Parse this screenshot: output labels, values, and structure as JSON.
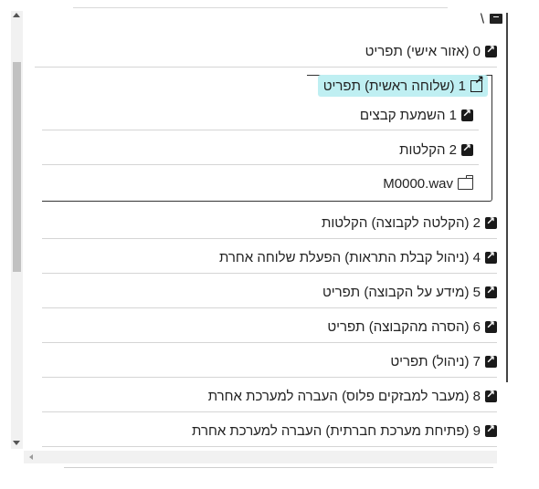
{
  "tree": {
    "root_separator": "\\",
    "items_top": [
      {
        "label": "0 (אזור אישי) תפריט",
        "icon": "shortcut-icon"
      }
    ],
    "selected": {
      "label": "1 (שלוחה ראשית) תפריט",
      "icon": "external-link-icon"
    },
    "children": [
      {
        "label": "1 השמעת קבצים",
        "icon": "shortcut-icon"
      },
      {
        "label": "2 הקלטות",
        "icon": "shortcut-icon"
      },
      {
        "label": "M0000.wav",
        "icon": "folder-icon"
      }
    ],
    "items": [
      {
        "label": "2 (הקלטה לקבוצה) הקלטות",
        "icon": "shortcut-icon"
      },
      {
        "label": "4 (ניהול קבלת התראות) הפעלת שלוחה אחרת",
        "icon": "shortcut-icon"
      },
      {
        "label": "5 (מידע על הקבוצה) תפריט",
        "icon": "shortcut-icon"
      },
      {
        "label": "6 (הסרה מהקבוצה) תפריט",
        "icon": "shortcut-icon"
      },
      {
        "label": "7 (ניהול) תפריט",
        "icon": "shortcut-icon"
      },
      {
        "label": "8 (מעבר למבזקים פלוס) העברה למערכת אחרת",
        "icon": "shortcut-icon"
      },
      {
        "label": "9 (פתיחת מערכת חברתית) העברה למערכת אחרת",
        "icon": "shortcut-icon"
      }
    ]
  },
  "colors": {
    "highlight": "#bfeff2",
    "divider": "#d5d5d5"
  }
}
